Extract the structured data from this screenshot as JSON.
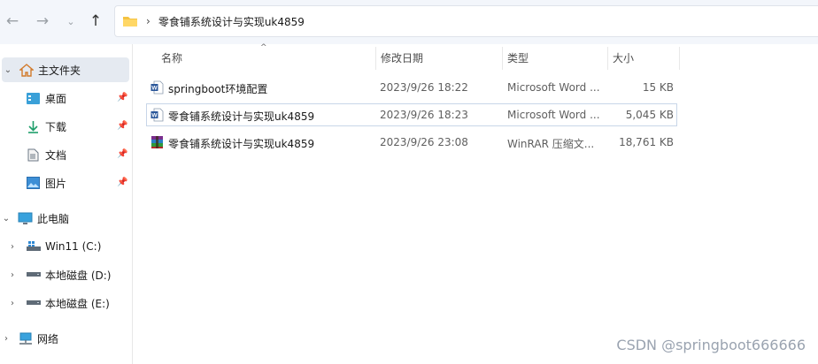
{
  "address": {
    "path": "零食铺系统设计与实现uk4859"
  },
  "sidebar": {
    "items": [
      {
        "label": "主文件夹",
        "icon": "home-icon"
      },
      {
        "label": "桌面",
        "icon": "desktop-icon"
      },
      {
        "label": "下载",
        "icon": "download-icon"
      },
      {
        "label": "文档",
        "icon": "document-icon"
      },
      {
        "label": "图片",
        "icon": "pictures-icon"
      },
      {
        "label": "此电脑",
        "icon": "computer-icon"
      },
      {
        "label": "Win11 (C:)",
        "icon": "drive-icon"
      },
      {
        "label": "本地磁盘 (D:)",
        "icon": "drive-icon"
      },
      {
        "label": "本地磁盘 (E:)",
        "icon": "drive-icon"
      },
      {
        "label": "网络",
        "icon": "network-icon"
      }
    ]
  },
  "columns": {
    "name": "名称",
    "date": "修改日期",
    "type": "类型",
    "size": "大小"
  },
  "files": [
    {
      "name": "springboot环境配置",
      "date": "2023/9/26 18:22",
      "type": "Microsoft Word ...",
      "size": "15 KB",
      "icon": "word-doc-icon"
    },
    {
      "name": "零食铺系统设计与实现uk4859",
      "date": "2023/9/26 18:23",
      "type": "Microsoft Word ...",
      "size": "5,045 KB",
      "icon": "word-doc-icon"
    },
    {
      "name": "零食铺系统设计与实现uk4859",
      "date": "2023/9/26 23:08",
      "type": "WinRAR 压缩文...",
      "size": "18,761 KB",
      "icon": "winrar-archive-icon"
    }
  ],
  "watermark": "CSDN @springboot666666",
  "colors": {
    "folder_yellow": "#f5c342",
    "word_blue": "#2b579a",
    "selection_bg": "#e5eaf1"
  }
}
